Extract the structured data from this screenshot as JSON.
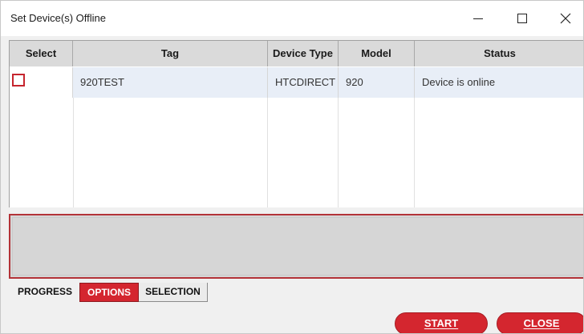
{
  "window": {
    "title": "Set Device(s) Offline",
    "controls": [
      "minimize-icon",
      "maximize-icon",
      "close-icon"
    ]
  },
  "grid": {
    "columns": [
      "Select",
      "Tag",
      "Device Type",
      "Model",
      "Status"
    ],
    "rows": [
      {
        "selected": false,
        "tag": "920TEST",
        "device_type": "HTCDIRECT",
        "model": "920",
        "status": "Device is online"
      }
    ]
  },
  "tabs": [
    {
      "label": "PROGRESS",
      "active": false
    },
    {
      "label": "OPTIONS",
      "active": true
    },
    {
      "label": "SELECTION",
      "active": false
    }
  ],
  "buttons": {
    "start": "START",
    "close": "CLOSE"
  },
  "colors": {
    "accent": "#d4262f",
    "row_highlight": "#e8eef7",
    "header_bg": "#dadada"
  }
}
